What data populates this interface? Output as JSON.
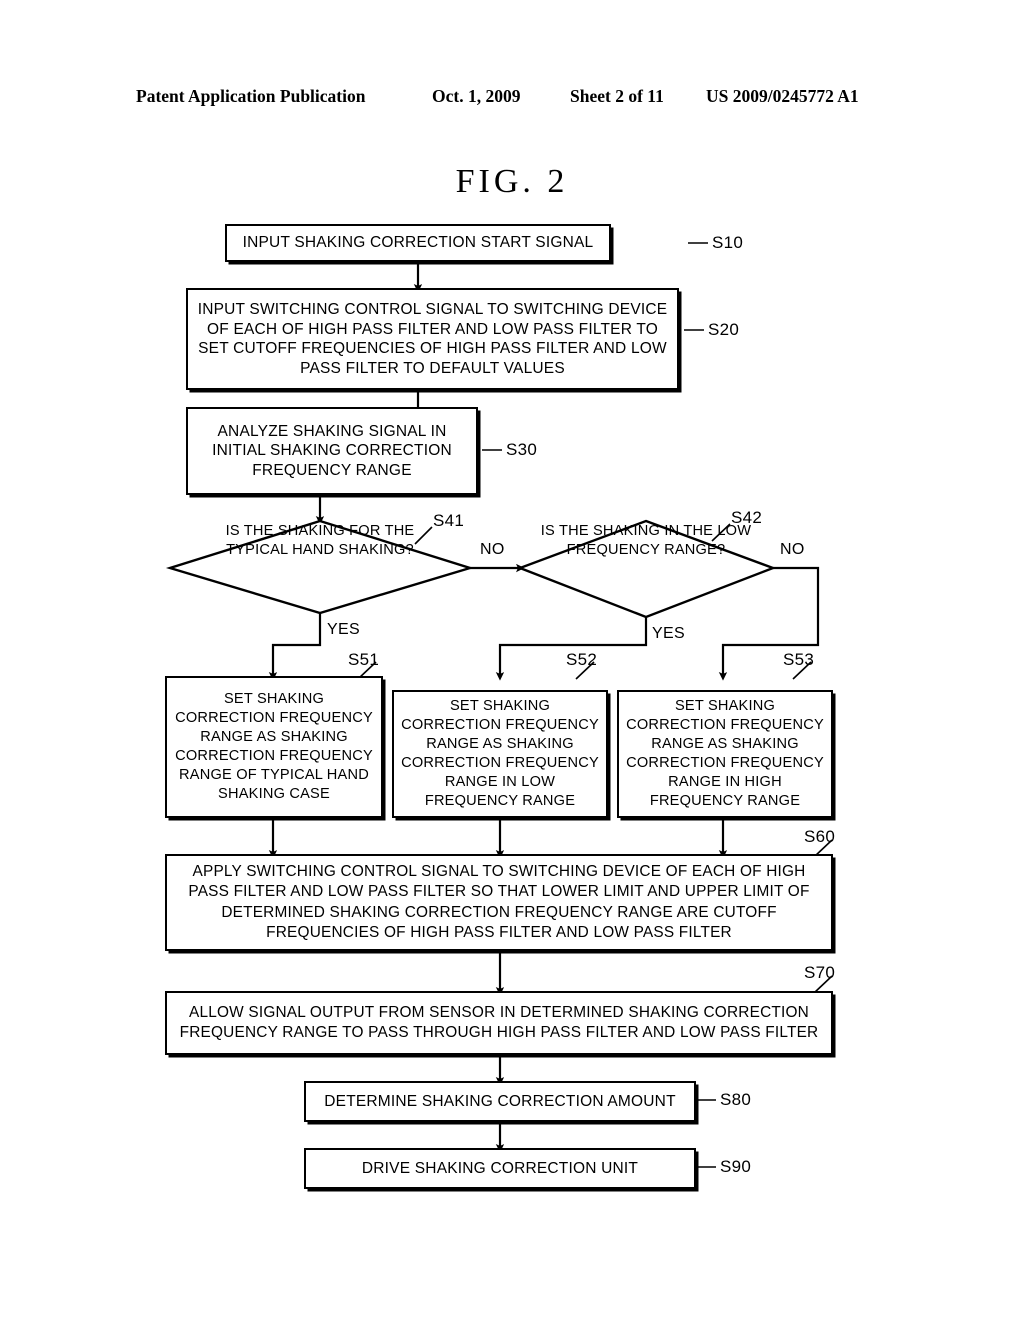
{
  "header": {
    "publication": "Patent Application Publication",
    "date": "Oct. 1, 2009",
    "sheet": "Sheet 2 of 11",
    "patent_number": "US 2009/0245772 A1"
  },
  "figure": {
    "title": "FIG.  2"
  },
  "labels": {
    "yes": "YES",
    "no": "NO"
  },
  "nodes": {
    "s10": {
      "ref": "S10",
      "text": "INPUT SHAKING CORRECTION START SIGNAL"
    },
    "s20": {
      "ref": "S20",
      "text": "INPUT SWITCHING CONTROL SIGNAL TO SWITCHING DEVICE OF EACH OF HIGH PASS FILTER AND LOW PASS FILTER TO SET CUTOFF FREQUENCIES OF HIGH PASS FILTER AND LOW PASS FILTER TO DEFAULT VALUES"
    },
    "s30": {
      "ref": "S30",
      "text": "ANALYZE SHAKING SIGNAL IN INITIAL SHAKING CORRECTION FREQUENCY RANGE"
    },
    "s41": {
      "ref": "S41",
      "text": "IS THE SHAKING FOR THE TYPICAL HAND SHAKING?",
      "yes_label": "YES",
      "no_label": "NO"
    },
    "s42": {
      "ref": "S42",
      "text": "IS THE SHAKING IN THE LOW FREQUENCY RANGE?",
      "yes_label": "YES",
      "no_label": "NO"
    },
    "s51": {
      "ref": "S51",
      "text": "SET SHAKING CORRECTION FREQUENCY RANGE AS SHAKING CORRECTION FREQUENCY RANGE OF TYPICAL HAND SHAKING CASE"
    },
    "s52": {
      "ref": "S52",
      "text": "SET SHAKING CORRECTION FREQUENCY RANGE AS SHAKING CORRECTION FREQUENCY RANGE IN LOW FREQUENCY RANGE"
    },
    "s53": {
      "ref": "S53",
      "text": "SET SHAKING CORRECTION FREQUENCY RANGE AS SHAKING CORRECTION FREQUENCY RANGE IN HIGH FREQUENCY RANGE"
    },
    "s60": {
      "ref": "S60",
      "text": "APPLY SWITCHING CONTROL SIGNAL TO SWITCHING DEVICE OF EACH OF HIGH PASS FILTER AND LOW PASS FILTER SO THAT LOWER LIMIT AND UPPER LIMIT OF DETERMINED SHAKING CORRECTION FREQUENCY RANGE ARE CUTOFF FREQUENCIES OF HIGH PASS FILTER AND LOW PASS FILTER"
    },
    "s70": {
      "ref": "S70",
      "text": "ALLOW SIGNAL OUTPUT FROM SENSOR IN DETERMINED SHAKING CORRECTION FREQUENCY RANGE TO PASS THROUGH HIGH PASS FILTER AND LOW PASS FILTER"
    },
    "s80": {
      "ref": "S80",
      "text": "DETERMINE SHAKING CORRECTION AMOUNT"
    },
    "s90": {
      "ref": "S90",
      "text": "DRIVE SHAKING CORRECTION UNIT"
    }
  }
}
